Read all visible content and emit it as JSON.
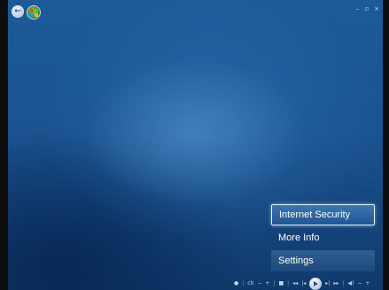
{
  "window_controls": {
    "minimize": "–",
    "restore": "▫",
    "close": "×"
  },
  "top_left": {
    "back_glyph": "←"
  },
  "menu": {
    "items": [
      {
        "label": "Internet Security",
        "state": "focused"
      },
      {
        "label": "More Info",
        "state": "normal"
      },
      {
        "label": "Settings",
        "state": "band"
      }
    ]
  },
  "transport": {
    "record": "●",
    "ch": "ch",
    "ch_down": "−",
    "ch_up": "+",
    "stop": "■",
    "rewind": "◂◂",
    "prev": "|◂",
    "next": "▸|",
    "fast_forward": "▸▸",
    "mute": "◀)",
    "vol_down": "−",
    "vol_up": "+"
  },
  "colors": {
    "background_blue": "#1a5390",
    "focus_highlight": "#3b77b3",
    "menu_text": "#ffffff"
  },
  "icons": [
    "back-icon",
    "windows-logo-icon",
    "play-icon",
    "record-icon",
    "stop-icon",
    "volume-icon"
  ]
}
